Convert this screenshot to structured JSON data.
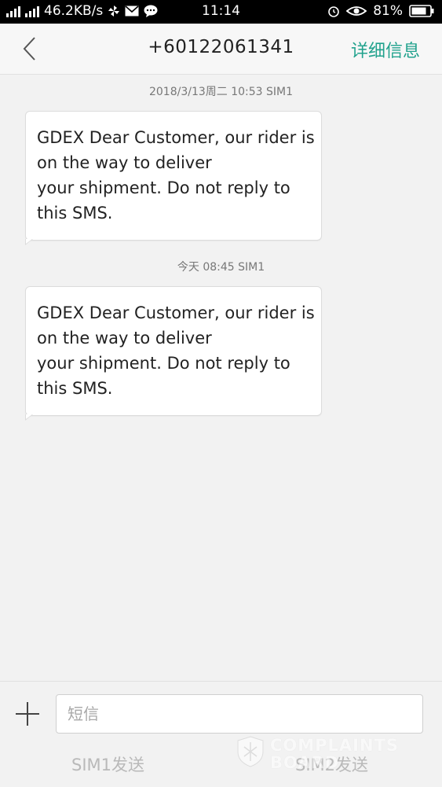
{
  "status_bar": {
    "net_speed": "46.2KB/s",
    "time": "11:14",
    "battery": "81%"
  },
  "header": {
    "title": "+60122061341",
    "details_label": "详细信息"
  },
  "messages": [
    {
      "timestamp": "2018/3/13周二  10:53  SIM1",
      "lines": [
        "GDEX Dear Customer, our rider is",
        "on the way to deliver",
        "your shipment. Do not reply to",
        "this SMS."
      ]
    },
    {
      "timestamp": "今天  08:45  SIM1",
      "lines": [
        "GDEX Dear Customer, our rider is",
        "on the way to deliver",
        "your shipment. Do not reply to",
        "this SMS."
      ]
    }
  ],
  "composer": {
    "placeholder": "短信",
    "send_sim1": "SIM1发送",
    "send_sim2": "SIM2发送"
  },
  "watermark": {
    "line1": "COMPLAINTS",
    "line2": "BOARD"
  },
  "colors": {
    "accent": "#21a28d",
    "status_bar_bg": "#000000",
    "page_bg": "#f2f2f2"
  }
}
